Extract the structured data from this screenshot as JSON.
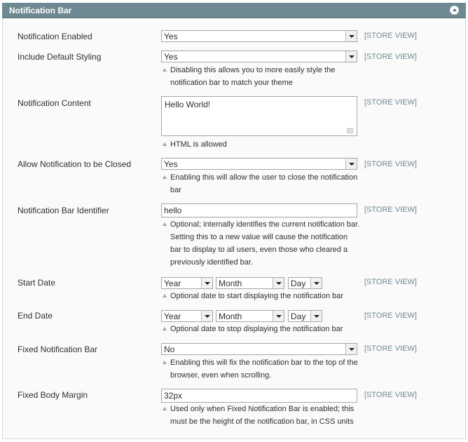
{
  "section": {
    "title": "Notification Bar"
  },
  "scope_label": "[STORE VIEW]",
  "fields": {
    "enabled": {
      "label": "Notification Enabled",
      "value": "Yes"
    },
    "default_styling": {
      "label": "Include Default Styling",
      "value": "Yes",
      "note_line1": "Disabling this allows you to more easily style the",
      "note_line2": "notification bar to match your theme"
    },
    "content": {
      "label": "Notification Content",
      "value": "Hello World!",
      "note_line1": "HTML is allowed"
    },
    "closable": {
      "label": "Allow Notification to be Closed",
      "value": "Yes",
      "note_line1": "Enabling this will allow the user to close the notification",
      "note_line2": "bar"
    },
    "identifier": {
      "label": "Notification Bar Identifier",
      "value": "hello",
      "note_line1": "Optional; internally identifies the current notification bar.",
      "note_line2": "Setting this to a new value will cause the notification",
      "note_line3": "bar to display to all users, even those who cleared a",
      "note_line4": "previously identified bar."
    },
    "start_date": {
      "label": "Start Date",
      "year": "Year",
      "month": "Month",
      "day": "Day",
      "note_line1": "Optional date to start displaying the notification bar"
    },
    "end_date": {
      "label": "End Date",
      "year": "Year",
      "month": "Month",
      "day": "Day",
      "note_line1": "Optional date to stop displaying the notification bar"
    },
    "fixed": {
      "label": "Fixed Notification Bar",
      "value": "No",
      "note_line1": "Enabling this will fix the notification bar to the top of the",
      "note_line2": "browser, even when scrolling."
    },
    "body_margin": {
      "label": "Fixed Body Margin",
      "value": "32px",
      "note_line1": "Used only when Fixed Notification Bar is enabled; this",
      "note_line2": "must be the height of the notification bar, in CSS units"
    }
  }
}
